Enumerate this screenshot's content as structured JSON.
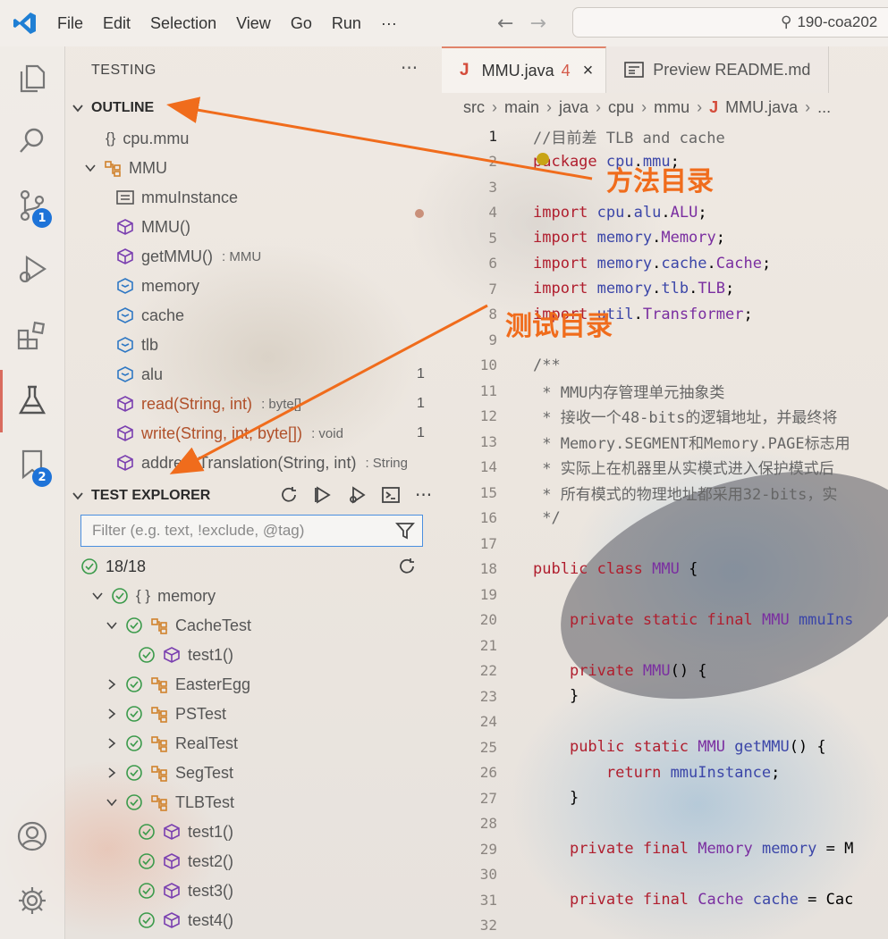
{
  "titlebar": {
    "menu": [
      "File",
      "Edit",
      "Selection",
      "View",
      "Go",
      "Run",
      "···"
    ],
    "back_arrow": "←",
    "forward_arrow": "→",
    "search_text": "190-coa202"
  },
  "activity_bar": {
    "items": [
      {
        "name": "explorer-icon"
      },
      {
        "name": "search-icon"
      },
      {
        "name": "source-control-icon",
        "badge": "1"
      },
      {
        "name": "run-debug-icon"
      },
      {
        "name": "extensions-icon"
      },
      {
        "name": "testing-icon",
        "active": true
      },
      {
        "name": "bookmark-icon",
        "badge": "2"
      }
    ],
    "bottom": [
      {
        "name": "account-icon"
      },
      {
        "name": "settings-gear-icon"
      }
    ]
  },
  "sidebar": {
    "title": "TESTING",
    "more": "···",
    "outline": {
      "header": "OUTLINE",
      "items": [
        {
          "icon": "namespace-icon",
          "label": "cpu.mmu",
          "detail": "",
          "count": ""
        },
        {
          "icon": "class-icon",
          "label": "MMU",
          "detail": "",
          "count": ""
        },
        {
          "icon": "field-icon",
          "label": "mmuInstance",
          "detail": "",
          "count": ""
        },
        {
          "icon": "method-icon",
          "label": "MMU()",
          "detail": "",
          "count": ""
        },
        {
          "icon": "method-icon",
          "label": "getMMU()",
          "detail": ": MMU",
          "count": ""
        },
        {
          "icon": "property-icon",
          "label": "memory",
          "detail": "",
          "count": ""
        },
        {
          "icon": "property-icon",
          "label": "cache",
          "detail": "",
          "count": ""
        },
        {
          "icon": "property-icon",
          "label": "tlb",
          "detail": "",
          "count": ""
        },
        {
          "icon": "property-icon",
          "label": "alu",
          "detail": "",
          "count": "1"
        },
        {
          "icon": "method-icon",
          "label": "read(String, int)",
          "detail": ": byte[]",
          "count": "1"
        },
        {
          "icon": "method-icon",
          "label": "write(String, int, byte[])",
          "detail": ": void",
          "count": "1"
        },
        {
          "icon": "method-icon",
          "label": "addressTranslation(String, int)",
          "detail": ": String",
          "count": ""
        }
      ]
    },
    "test_explorer": {
      "header": "TEST EXPLORER",
      "filter_placeholder": "Filter (e.g. text, !exclude, @tag)",
      "summary": "18/18",
      "items": [
        {
          "label": "memory",
          "kind": "namespace",
          "expanded": true
        },
        {
          "label": "CacheTest",
          "kind": "class",
          "expanded": true
        },
        {
          "label": "test1()",
          "kind": "method",
          "expanded": null
        },
        {
          "label": "EasterEgg",
          "kind": "class",
          "expanded": false
        },
        {
          "label": "PSTest",
          "kind": "class",
          "expanded": false
        },
        {
          "label": "RealTest",
          "kind": "class",
          "expanded": false
        },
        {
          "label": "SegTest",
          "kind": "class",
          "expanded": false
        },
        {
          "label": "TLBTest",
          "kind": "class",
          "expanded": true
        },
        {
          "label": "test1()",
          "kind": "method",
          "expanded": null
        },
        {
          "label": "test2()",
          "kind": "method",
          "expanded": null
        },
        {
          "label": "test3()",
          "kind": "method",
          "expanded": null
        },
        {
          "label": "test4()",
          "kind": "method",
          "expanded": null
        }
      ]
    }
  },
  "editor": {
    "tabs": [
      {
        "label": "MMU.java",
        "problems": "4",
        "active": true,
        "close": "×"
      },
      {
        "label": "Preview README.md",
        "active": false
      }
    ],
    "breadcrumb": [
      "src",
      "main",
      "java",
      "cpu",
      "mmu",
      "MMU.java",
      "..."
    ],
    "current_line": "1",
    "lines": [
      {
        "n": "1",
        "text": "//目前差 TLB and cache"
      },
      {
        "n": "2",
        "text": "package cpu.mmu;"
      },
      {
        "n": "3",
        "text": ""
      },
      {
        "n": "4",
        "text": "import cpu.alu.ALU;"
      },
      {
        "n": "5",
        "text": "import memory.Memory;"
      },
      {
        "n": "6",
        "text": "import memory.cache.Cache;"
      },
      {
        "n": "7",
        "text": "import memory.tlb.TLB;"
      },
      {
        "n": "8",
        "text": "import util.Transformer;"
      },
      {
        "n": "9",
        "text": ""
      },
      {
        "n": "10",
        "text": "/**"
      },
      {
        "n": "11",
        "text": " * MMU内存管理单元抽象类"
      },
      {
        "n": "12",
        "text": " * 接收一个48-bits的逻辑地址，并最终将"
      },
      {
        "n": "13",
        "text": " * Memory.SEGMENT和Memory.PAGE标志用"
      },
      {
        "n": "14",
        "text": " * 实际上在机器里从实模式进入保护模式后"
      },
      {
        "n": "15",
        "text": " * 所有模式的物理地址都采用32-bits，实"
      },
      {
        "n": "16",
        "text": " */"
      },
      {
        "n": "17",
        "text": ""
      },
      {
        "n": "18",
        "text": "public class MMU {"
      },
      {
        "n": "19",
        "text": ""
      },
      {
        "n": "20",
        "text": "    private static final MMU mmuIns"
      },
      {
        "n": "21",
        "text": ""
      },
      {
        "n": "22",
        "text": "    private MMU() {"
      },
      {
        "n": "23",
        "text": "    }"
      },
      {
        "n": "24",
        "text": ""
      },
      {
        "n": "25",
        "text": "    public static MMU getMMU() {"
      },
      {
        "n": "26",
        "text": "        return mmuInstance;"
      },
      {
        "n": "27",
        "text": "    }"
      },
      {
        "n": "28",
        "text": ""
      },
      {
        "n": "29",
        "text": "    private final Memory memory = M"
      },
      {
        "n": "30",
        "text": ""
      },
      {
        "n": "31",
        "text": "    private final Cache cache = Cac"
      },
      {
        "n": "32",
        "text": ""
      }
    ]
  },
  "annotations": {
    "outline_label": "方法目录",
    "test_label": "测试目录",
    "color": "#f06c1c"
  }
}
